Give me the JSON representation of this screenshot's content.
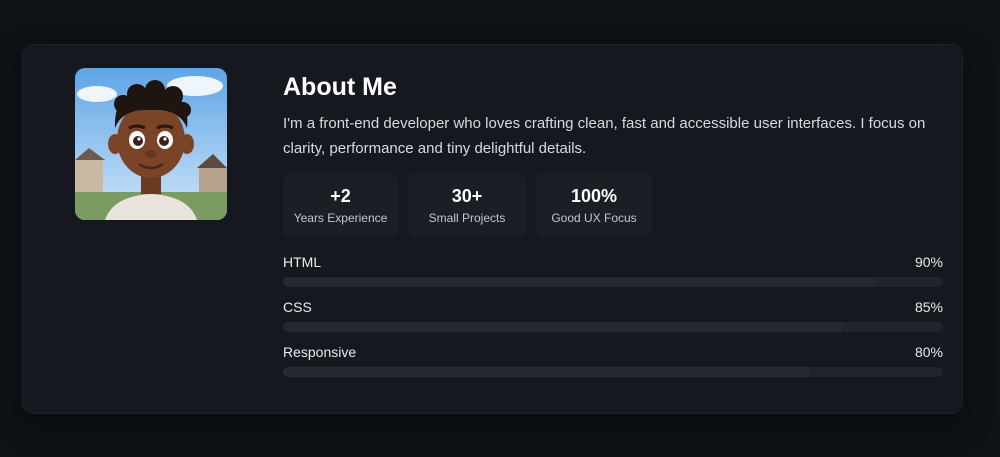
{
  "about": {
    "title": "About Me",
    "bio": "I'm a front-end developer who loves crafting clean, fast and accessible user interfaces. I focus on clarity, performance and tiny delightful details."
  },
  "avatar": {
    "icon": "cartoon-boy-portrait"
  },
  "stats": [
    {
      "value": "+2",
      "label": "Years Experience"
    },
    {
      "value": "30+",
      "label": "Small Projects"
    },
    {
      "value": "100%",
      "label": "Good UX Focus"
    }
  ],
  "skills": [
    {
      "name": "HTML",
      "percent_label": "90%",
      "percent": 90
    },
    {
      "name": "CSS",
      "percent_label": "85%",
      "percent": 85
    },
    {
      "name": "Responsive",
      "percent_label": "80%",
      "percent": 80
    }
  ]
}
